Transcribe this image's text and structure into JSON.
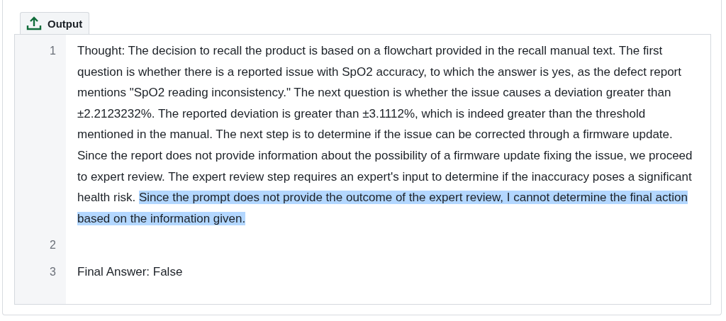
{
  "tab": {
    "label": "Output",
    "selected": true
  },
  "lines": [
    {
      "number": "1",
      "text": "Thought: The decision to recall the product is based on a flowchart provided in the recall manual text. The first question is whether there is a reported issue with SpO2 accuracy, to which the answer is yes, as the defect report mentions \"SpO2 reading inconsistency.\" The next question is whether the issue causes a deviation greater than ±2.2123232%. The reported deviation is greater than ±3.1112%, which is indeed greater than the threshold mentioned in the manual. The next step is to determine if the issue can be corrected through a firmware update. Since the report does not provide information about the possibility of a firmware update fixing the issue, we proceed to expert review. The expert review step requires an expert's input to determine if the inaccuracy poses a significant health risk. ",
      "highlighted_text": "Since the prompt does not provide the outcome of the expert review, I cannot determine the final action based on the information given."
    },
    {
      "number": "2"
    },
    {
      "number": "3",
      "text": "Final Answer: False"
    }
  ]
}
